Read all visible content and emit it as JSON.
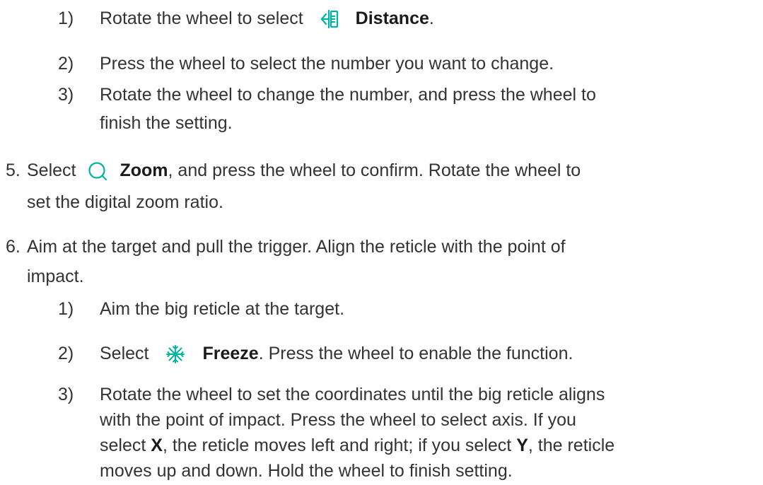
{
  "accent_color": "#00b4a0",
  "step4": {
    "items": [
      {
        "num": "1)",
        "pre": "Rotate the wheel to select",
        "icon": "distance-icon",
        "bold": "Distance",
        "post": "."
      },
      {
        "num": "2)",
        "text": "Press the wheel to select the number you want to change."
      },
      {
        "num": "3)",
        "lines": [
          "Rotate the wheel to change the number, and press the wheel to",
          "finish the setting."
        ]
      }
    ]
  },
  "step5": {
    "num": "5.",
    "pre": "Select",
    "icon": "zoom-icon",
    "bold": "Zoom",
    "post": ", and press the wheel to confirm. Rotate the wheel to",
    "line2": "set the digital zoom ratio."
  },
  "step6": {
    "num": "6.",
    "line1": "Aim at the target and pull the trigger. Align the reticle with the point of",
    "line2": "impact.",
    "items": [
      {
        "num": "1)",
        "text": "Aim the big reticle at the target."
      },
      {
        "num": "2)",
        "pre": "Select",
        "icon": "freeze-icon",
        "bold": "Freeze",
        "post": ". Press the wheel to enable the function."
      },
      {
        "num": "3)",
        "l1": "Rotate the wheel to set the coordinates until the big reticle aligns",
        "l2": "with the point of impact. Press the wheel to select axis. If you",
        "l3_a": "select ",
        "l3_x": "X",
        "l3_b": ", the reticle moves left and right; if you select ",
        "l3_y": "Y",
        "l3_c": ", the reticle",
        "l4": "moves up and down. Hold the wheel to finish setting."
      }
    ]
  }
}
